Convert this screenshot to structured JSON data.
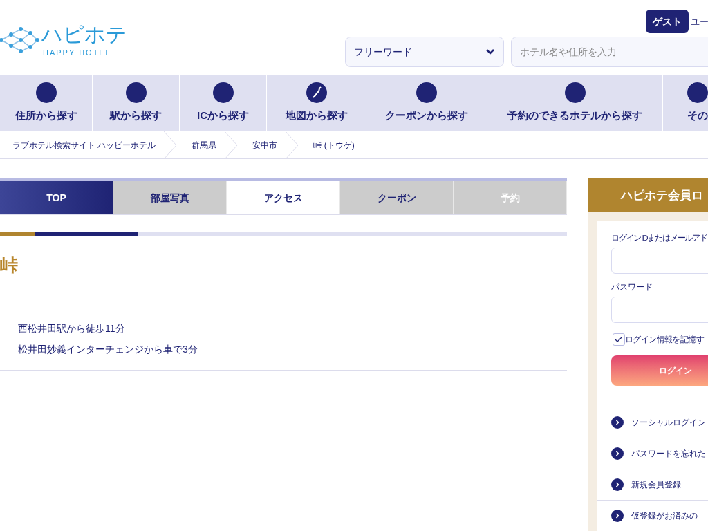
{
  "header": {
    "logo": {
      "title": "ハピホテ",
      "subtitle": "HAPPY HOTEL"
    },
    "guest_badge": "ゲスト",
    "user_link": "ユー",
    "search_type": "フリーワード",
    "search": {
      "placeholder": "ホテル名や住所を入力"
    }
  },
  "nav": [
    {
      "label": "住所から探す"
    },
    {
      "label": "駅から探す"
    },
    {
      "label": "ICから探す"
    },
    {
      "label": "地図から探す"
    },
    {
      "label": "クーポンから探す"
    },
    {
      "label": "予約のできるホテルから探す"
    },
    {
      "label": "その"
    }
  ],
  "breadcrumb": [
    "ラブホテル検索サイト ハッピーホテル",
    "群馬県",
    "安中市",
    "峠 (トウゲ)"
  ],
  "tabs": [
    {
      "label": "TOP",
      "selected": false,
      "disabled": false
    },
    {
      "label": "部屋写真",
      "selected": false,
      "disabled": false
    },
    {
      "label": "アクセス",
      "selected": true,
      "disabled": false
    },
    {
      "label": "クーポン",
      "selected": false,
      "disabled": false
    },
    {
      "label": "予約",
      "selected": false,
      "disabled": true
    }
  ],
  "hotel_name": "峠",
  "access": [
    "西松井田駅から徒歩11分",
    "松井田妙義インターチェンジから車で3分"
  ],
  "login": {
    "title": "ハピホテ会員ロ",
    "id_label": "ログインIDまたはメールアド",
    "password_label": "パスワード",
    "remember": {
      "label": "ログイン情報を記憶す",
      "checked": true
    },
    "button": "ログイン",
    "links": [
      "ソーシャルログイン",
      "パスワードを忘れた",
      "新規会員登録",
      "仮登録がお済みの"
    ]
  }
}
